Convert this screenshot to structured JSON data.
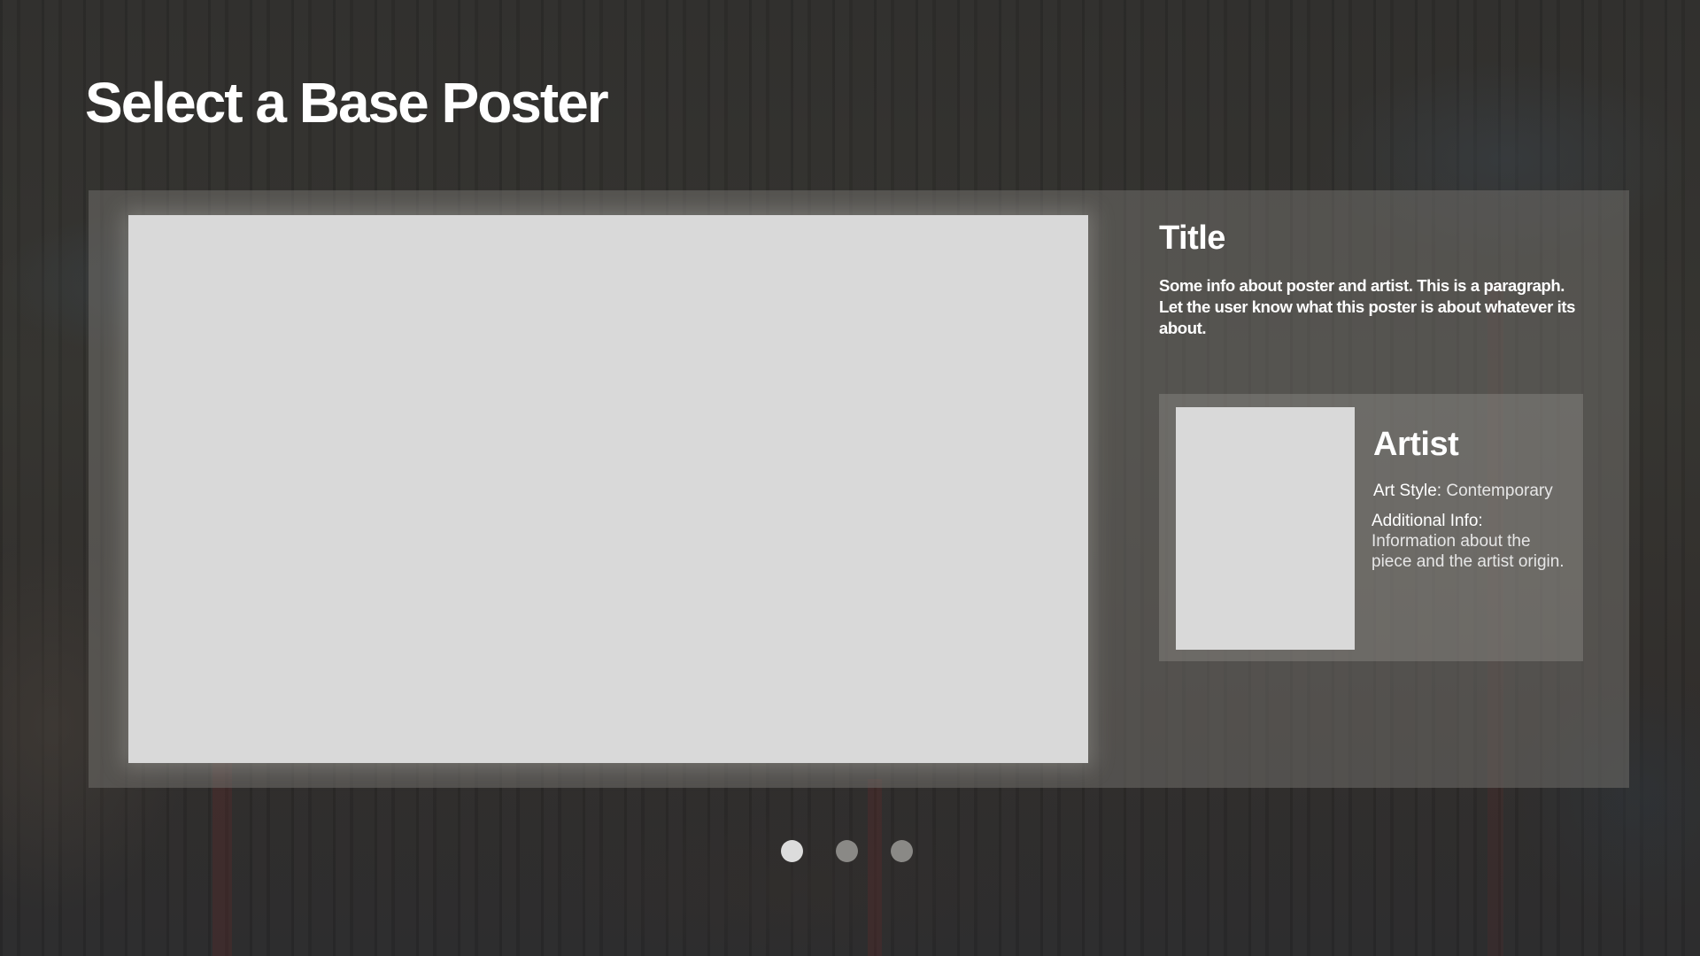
{
  "page": {
    "title": "Select a Base Poster"
  },
  "poster": {
    "title": "Title",
    "description": "Some info about poster and artist. This is a paragraph. Let the user know what this poster is about whatever its about."
  },
  "artist": {
    "heading": "Artist",
    "art_style_label": "Art Style:",
    "art_style_value": "Contemporary",
    "additional_info_label": "Additional Info:",
    "additional_info_value": "Information about the piece and the artist origin."
  },
  "pagination": {
    "total": 3,
    "active_index": 0
  },
  "colors": {
    "placeholder": "#d9d9d9",
    "dot_active": "#dcdcdc",
    "dot_inactive": "#8a8986"
  }
}
